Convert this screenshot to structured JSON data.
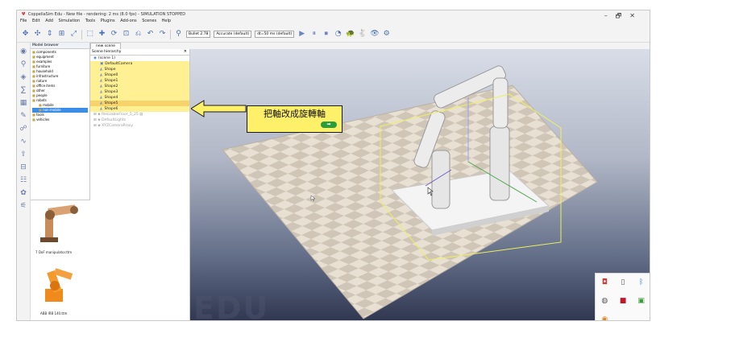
{
  "window": {
    "title": "CoppeliaSim Edu - New file - rendering: 2 ms (8.0 fps) - SIMULATION STOPPED",
    "controls": [
      "–",
      "🗗",
      "✕"
    ]
  },
  "menu": [
    "File",
    "Edit",
    "Add",
    "Simulation",
    "Tools",
    "Plugins",
    "Add-ons",
    "Scenes",
    "Help"
  ],
  "toolbar": {
    "engine_select": "Bullet 2.78",
    "accuracy_select": "Accurate (default)",
    "dt_select": "dt=50 ms (default)"
  },
  "model_browser": {
    "title": "Model browser",
    "items": [
      {
        "label": "components",
        "indent": 0
      },
      {
        "label": "equipment",
        "indent": 0
      },
      {
        "label": "examples",
        "indent": 0
      },
      {
        "label": "furniture",
        "indent": 0
      },
      {
        "label": "household",
        "indent": 0
      },
      {
        "label": "infrastructure",
        "indent": 0
      },
      {
        "label": "nature",
        "indent": 0
      },
      {
        "label": "office items",
        "indent": 0
      },
      {
        "label": "other",
        "indent": 0
      },
      {
        "label": "people",
        "indent": 0
      },
      {
        "label": "robots",
        "indent": 0
      },
      {
        "label": "mobile",
        "indent": 1
      },
      {
        "label": "non-mobile",
        "indent": 1,
        "selected": true
      },
      {
        "label": "tools",
        "indent": 0
      },
      {
        "label": "vehicles",
        "indent": 0
      }
    ],
    "thumbnails": [
      {
        "label": "7 DoF manipulator.ttm"
      },
      {
        "label": "ABB IRB 140.ttm"
      }
    ]
  },
  "scene_tab": "new scene",
  "scene_hierarchy": {
    "title": "Scene hierarchy",
    "root": "(scene 1)",
    "items": [
      {
        "label": "DefaultCamera",
        "icon": "camera-icon"
      },
      {
        "label": "Shape",
        "icon": "shape-icon"
      },
      {
        "label": "Shape0",
        "icon": "shape-icon"
      },
      {
        "label": "Shape1",
        "icon": "shape-icon"
      },
      {
        "label": "Shape2",
        "icon": "shape-icon"
      },
      {
        "label": "Shape3",
        "icon": "shape-icon"
      },
      {
        "label": "Shape4",
        "icon": "shape-icon"
      },
      {
        "label": "Shape5",
        "icon": "shape-icon",
        "selected": true
      },
      {
        "label": "Shape6",
        "icon": "shape-icon"
      }
    ],
    "grey_items": [
      "ResizableFloor_5_25",
      "DefaultLights",
      "XYZCameraProxy"
    ]
  },
  "callout": {
    "text": "把軸改成旋轉軸",
    "button": "➡"
  },
  "watermark": "EDU",
  "colors": {
    "highlight_yellow": "#fff193",
    "selected_row": "#f8d36b",
    "callout_bg": "#fff06a",
    "accent_blue": "#3b8de6"
  }
}
